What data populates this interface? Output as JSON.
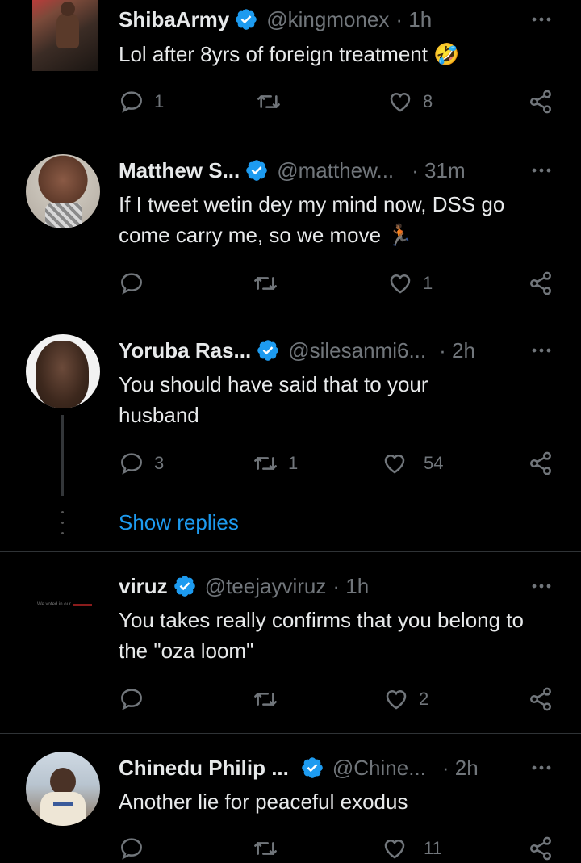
{
  "tweets": [
    {
      "name": "ShibaArmy",
      "handle": "@kingmonex",
      "time": "· 1h",
      "text": "Lol after 8yrs of foreign treatment 🤣",
      "replies": "1",
      "retweets": "",
      "likes": "8"
    },
    {
      "name": "Matthew S...",
      "handle": "@matthew...",
      "time": "· 31m",
      "text": "If I tweet wetin dey my mind now, DSS go come carry me, so we move 🏃🏾",
      "replies": "",
      "retweets": "",
      "likes": "1"
    },
    {
      "name": "Yoruba Ras...",
      "handle": "@silesanmi6...",
      "time": "· 2h",
      "text": "You should have said that to your husband",
      "replies": "3",
      "retweets": "1",
      "likes": "54"
    },
    {
      "name": "viruz",
      "handle": "@teejayviruz",
      "time": "· 1h",
      "text": "You takes really confirms that you belong to the \"oza loom\"",
      "replies": "",
      "retweets": "",
      "likes": "2",
      "avatar_text": "We voted in our"
    },
    {
      "name": "Chinedu Philip ...",
      "handle": "@Chine...",
      "time": "· 2h",
      "text": "Another lie for peaceful exodus",
      "replies": "",
      "retweets": "",
      "likes": "11"
    }
  ],
  "show_replies": "Show replies",
  "colors": {
    "background": "#000000",
    "text": "#e7e9ea",
    "muted": "#71767b",
    "accent": "#1d9bf0",
    "divider": "#2f3336"
  }
}
